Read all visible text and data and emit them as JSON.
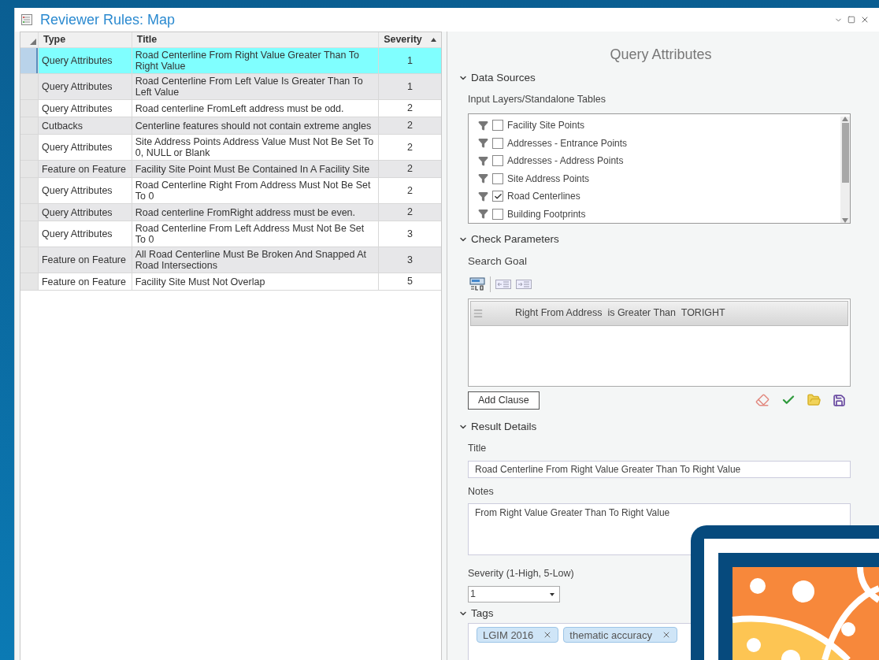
{
  "window": {
    "title": "Reviewer Rules: Map"
  },
  "rules_table": {
    "columns": [
      {
        "label": "Type",
        "sorted": false
      },
      {
        "label": "Title",
        "sorted": false
      },
      {
        "label": "Severity",
        "sorted": true
      }
    ],
    "rows": [
      {
        "type": "Query Attributes",
        "title": "Road Centerline From Right Value Greater Than To Right Value",
        "severity": "1",
        "selected": true
      },
      {
        "type": "Query Attributes",
        "title": "Road Centerline From Left Value Is Greater Than To Left Value",
        "severity": "1",
        "selected": false
      },
      {
        "type": "Query Attributes",
        "title": "Road centerline FromLeft address must be odd.",
        "severity": "2",
        "selected": false
      },
      {
        "type": "Cutbacks",
        "title": "Centerline features should not contain extreme angles",
        "severity": "2",
        "selected": false
      },
      {
        "type": "Query Attributes",
        "title": "Site Address Points Address Value Must Not Be Set To 0, NULL or Blank",
        "severity": "2",
        "selected": false
      },
      {
        "type": "Feature on Feature",
        "title": "Facility Site Point Must Be Contained In A Facility Site",
        "severity": "2",
        "selected": false
      },
      {
        "type": "Query Attributes",
        "title": "Road Centerline Right From Address Must Not Be Set To 0",
        "severity": "2",
        "selected": false
      },
      {
        "type": "Query Attributes",
        "title": "Road centerline FromRight address must be even.",
        "severity": "2",
        "selected": false
      },
      {
        "type": "Query Attributes",
        "title": "Road Centerline From Left Address Must Not Be Set To 0",
        "severity": "3",
        "selected": false
      },
      {
        "type": "Feature on Feature",
        "title": "All Road Centerline Must Be Broken And Snapped At Road Intersections",
        "severity": "3",
        "selected": false
      },
      {
        "type": "Feature on Feature",
        "title": "Facility Site Must Not Overlap",
        "severity": "5",
        "selected": false
      }
    ]
  },
  "details": {
    "heading": "Query Attributes",
    "data_sources": {
      "label": "Data Sources",
      "expanded": true,
      "input_label": "Input Layers/Standalone Tables",
      "layers": [
        {
          "name": "Facility Site Points",
          "checked": false
        },
        {
          "name": "Addresses - Entrance Points",
          "checked": false
        },
        {
          "name": "Addresses - Address Points",
          "checked": false
        },
        {
          "name": "Site Address Points",
          "checked": false
        },
        {
          "name": "Road Centerlines",
          "checked": true
        },
        {
          "name": "Building Footprints",
          "checked": false
        }
      ]
    },
    "check_parameters": {
      "label": "Check Parameters",
      "expanded": true,
      "search_goal_label": "Search Goal",
      "clauses": [
        {
          "text": "Right From Address  is Greater Than  TORIGHT"
        }
      ],
      "add_clause_button": "Add Clause"
    },
    "result_details": {
      "label": "Result Details",
      "expanded": true,
      "title_label": "Title",
      "title_value": "Road Centerline From Right Value Greater Than To Right Value",
      "notes_label": "Notes",
      "notes_value": "From Right Value Greater Than To Right Value",
      "severity_label": "Severity (1-High, 5-Low)",
      "severity_value": "1"
    },
    "tags": {
      "label": "Tags",
      "expanded": true,
      "items": [
        {
          "label": "LGIM 2016"
        },
        {
          "label": "thematic accuracy"
        }
      ]
    }
  }
}
